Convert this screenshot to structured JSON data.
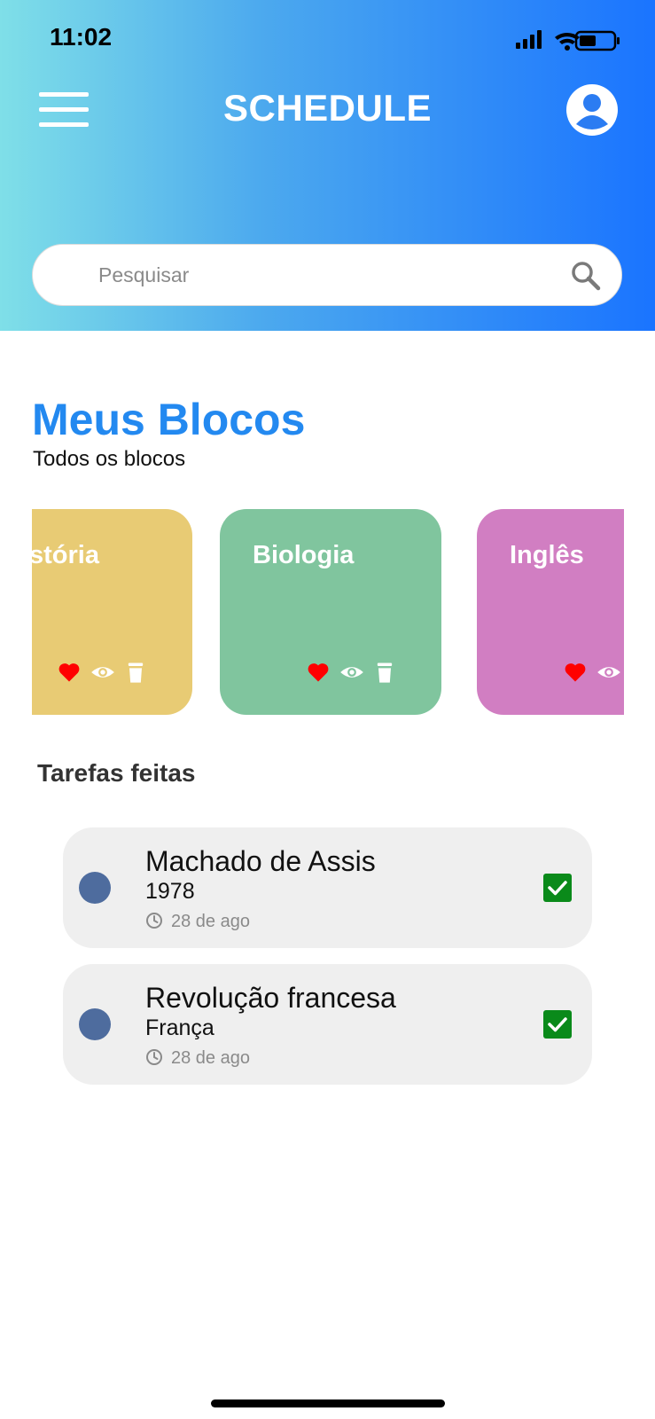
{
  "status": {
    "time": "11:02"
  },
  "header": {
    "title": "SCHEDULE",
    "menu_icon": "menu-icon",
    "avatar_icon": "user-avatar-icon"
  },
  "search": {
    "placeholder": "Pesquisar",
    "value": "",
    "icon": "search-icon"
  },
  "blocks": {
    "title": "Meus Blocos",
    "subtitle": "Todos os blocos",
    "cards": [
      {
        "label": "História",
        "color": "#e8cb74"
      },
      {
        "label": "Biologia",
        "color": "#80c59e"
      },
      {
        "label": "Inglês",
        "color": "#d17ec2"
      }
    ],
    "card_actions": [
      "heart-icon",
      "eye-icon",
      "trash-icon"
    ]
  },
  "done": {
    "title": "Tarefas feitas",
    "tasks": [
      {
        "title": "Machado de Assis",
        "subtitle": "1978",
        "date": "28 de ago",
        "checked": true
      },
      {
        "title": "Revolução francesa",
        "subtitle": "França",
        "date": "28 de ago",
        "checked": true
      }
    ]
  },
  "colors": {
    "accent": "#2389f0",
    "gradient_start": "#7fdfe8",
    "gradient_end": "#1a74ff",
    "heart": "#ff0000",
    "check": "#0a8a1a",
    "task_dot": "#4e6c9e"
  }
}
